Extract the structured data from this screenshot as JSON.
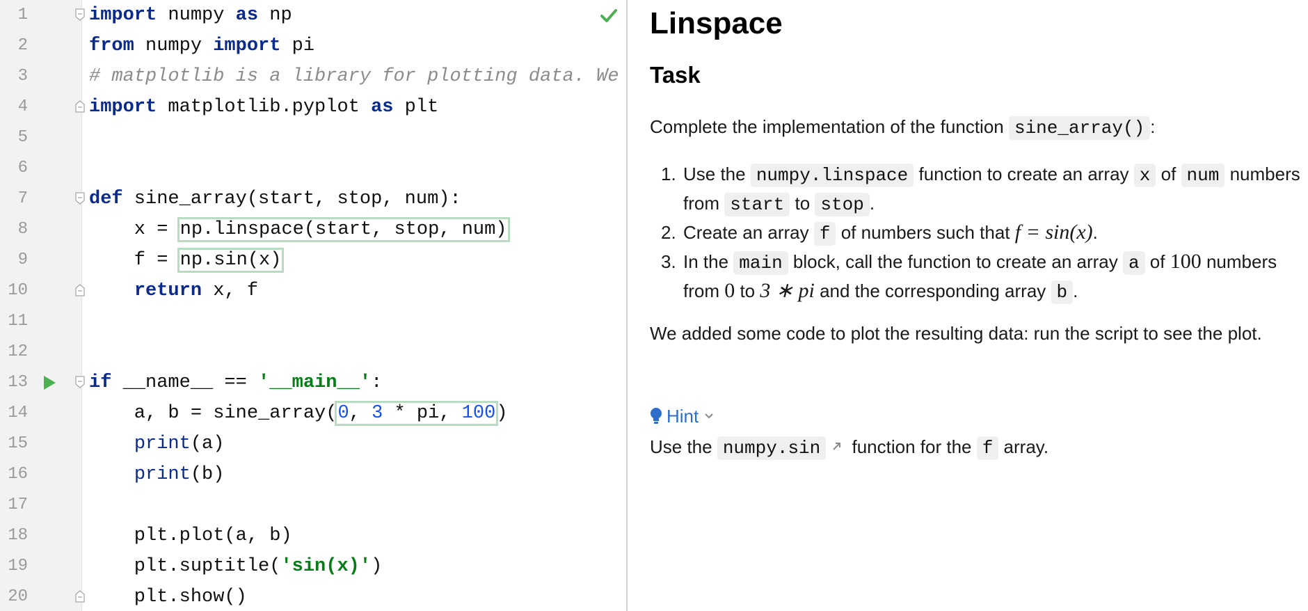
{
  "editor": {
    "lines": [
      {
        "number": "1",
        "tokens": [
          {
            "t": "import",
            "c": "kw"
          },
          {
            "t": " numpy ",
            "c": ""
          },
          {
            "t": "as",
            "c": "kw"
          },
          {
            "t": " np",
            "c": ""
          }
        ]
      },
      {
        "number": "2",
        "tokens": [
          {
            "t": "from",
            "c": "kw"
          },
          {
            "t": " numpy ",
            "c": ""
          },
          {
            "t": "import",
            "c": "kw"
          },
          {
            "t": " pi",
            "c": ""
          }
        ]
      },
      {
        "number": "3",
        "tokens": [
          {
            "t": "# matplotlib is a library for plotting data. We wi",
            "c": "com"
          }
        ]
      },
      {
        "number": "4",
        "tokens": [
          {
            "t": "import",
            "c": "kw"
          },
          {
            "t": " matplotlib.pyplot ",
            "c": ""
          },
          {
            "t": "as",
            "c": "kw"
          },
          {
            "t": " plt",
            "c": ""
          }
        ]
      },
      {
        "number": "5",
        "tokens": []
      },
      {
        "number": "6",
        "tokens": []
      },
      {
        "number": "7",
        "tokens": [
          {
            "t": "def",
            "c": "kw"
          },
          {
            "t": " sine_array(start, stop, num):",
            "c": ""
          }
        ]
      },
      {
        "number": "8",
        "tokens": [
          {
            "t": "    x = ",
            "c": ""
          },
          {
            "t": "np.linspace(start, stop, num)",
            "c": "ph"
          }
        ]
      },
      {
        "number": "9",
        "tokens": [
          {
            "t": "    f = ",
            "c": ""
          },
          {
            "t": "np.sin(x)",
            "c": "ph"
          }
        ]
      },
      {
        "number": "10",
        "tokens": [
          {
            "t": "    ",
            "c": ""
          },
          {
            "t": "return",
            "c": "kw"
          },
          {
            "t": " x, f",
            "c": ""
          }
        ]
      },
      {
        "number": "11",
        "tokens": []
      },
      {
        "number": "12",
        "tokens": []
      },
      {
        "number": "13",
        "tokens": [
          {
            "t": "if",
            "c": "kw"
          },
          {
            "t": " __name__ == ",
            "c": ""
          },
          {
            "t": "'__main__'",
            "c": "str"
          },
          {
            "t": ":",
            "c": ""
          }
        ]
      },
      {
        "number": "14",
        "tokens": [
          {
            "t": "    a, b = sine_array(",
            "c": ""
          },
          {
            "t": "0, 3 * pi, 100",
            "c": "ph-num"
          },
          {
            "t": ")",
            "c": ""
          }
        ]
      },
      {
        "number": "15",
        "tokens": [
          {
            "t": "    ",
            "c": ""
          },
          {
            "t": "print",
            "c": "bi"
          },
          {
            "t": "(a)",
            "c": ""
          }
        ]
      },
      {
        "number": "16",
        "tokens": [
          {
            "t": "    ",
            "c": ""
          },
          {
            "t": "print",
            "c": "bi"
          },
          {
            "t": "(b)",
            "c": ""
          }
        ]
      },
      {
        "number": "17",
        "tokens": []
      },
      {
        "number": "18",
        "tokens": [
          {
            "t": "    plt.plot(a, b)",
            "c": ""
          }
        ]
      },
      {
        "number": "19",
        "tokens": [
          {
            "t": "    plt.suptitle(",
            "c": ""
          },
          {
            "t": "'sin(x)'",
            "c": "str"
          },
          {
            "t": ")",
            "c": ""
          }
        ]
      },
      {
        "number": "20",
        "tokens": [
          {
            "t": "    plt.show()",
            "c": ""
          }
        ]
      }
    ],
    "fold_start_lines": [
      "1",
      "7",
      "13"
    ],
    "fold_end_lines": [
      "4",
      "10",
      "20"
    ],
    "run_line": "13",
    "status_icon": "checkmark-icon"
  },
  "task": {
    "title": "Linspace",
    "subtitle": "Task",
    "intro": [
      "Complete the implementation of the function ",
      "sine_array()",
      ":"
    ],
    "steps": [
      {
        "num": "1.",
        "parts": [
          {
            "t": "Use the ",
            "k": "text"
          },
          {
            "t": "numpy.linspace",
            "k": "code"
          },
          {
            "t": " function to create an array ",
            "k": "text"
          },
          {
            "t": "x",
            "k": "code"
          },
          {
            "t": " of ",
            "k": "text"
          },
          {
            "t": "num",
            "k": "code"
          },
          {
            "t": " numbers from ",
            "k": "text"
          },
          {
            "t": "start",
            "k": "code"
          },
          {
            "t": " to ",
            "k": "text"
          },
          {
            "t": "stop",
            "k": "code"
          },
          {
            "t": ".",
            "k": "text"
          }
        ]
      },
      {
        "num": "2.",
        "parts": [
          {
            "t": "Create an array ",
            "k": "text"
          },
          {
            "t": "f",
            "k": "code"
          },
          {
            "t": " of numbers such that ",
            "k": "text"
          },
          {
            "t": "f = sin(x)",
            "k": "math"
          },
          {
            "t": ".",
            "k": "text"
          }
        ]
      },
      {
        "num": "3.",
        "parts": [
          {
            "t": "In the ",
            "k": "text"
          },
          {
            "t": "main",
            "k": "code"
          },
          {
            "t": " block, call the function to create an array ",
            "k": "text"
          },
          {
            "t": "a",
            "k": "code"
          },
          {
            "t": " of ",
            "k": "text"
          },
          {
            "t": "100",
            "k": "mathnum"
          },
          {
            "t": " numbers from ",
            "k": "text"
          },
          {
            "t": "0",
            "k": "mathnum"
          },
          {
            "t": " to ",
            "k": "text"
          },
          {
            "t": "3 ∗ pi",
            "k": "math"
          },
          {
            "t": " and the corresponding array ",
            "k": "text"
          },
          {
            "t": "b",
            "k": "code"
          },
          {
            "t": ".",
            "k": "text"
          }
        ]
      }
    ],
    "outro": "We added some code to plot the resulting data: run the script to see the plot.",
    "hint": {
      "label": "Hint",
      "text_before": "Use the ",
      "code": "numpy.sin",
      "text_middle": " function for the ",
      "code2": "f",
      "text_after": " array."
    },
    "colors": {
      "link": "#2f6fca",
      "placeholder_border": "#b8dcc0",
      "check": "#4caf50"
    }
  }
}
